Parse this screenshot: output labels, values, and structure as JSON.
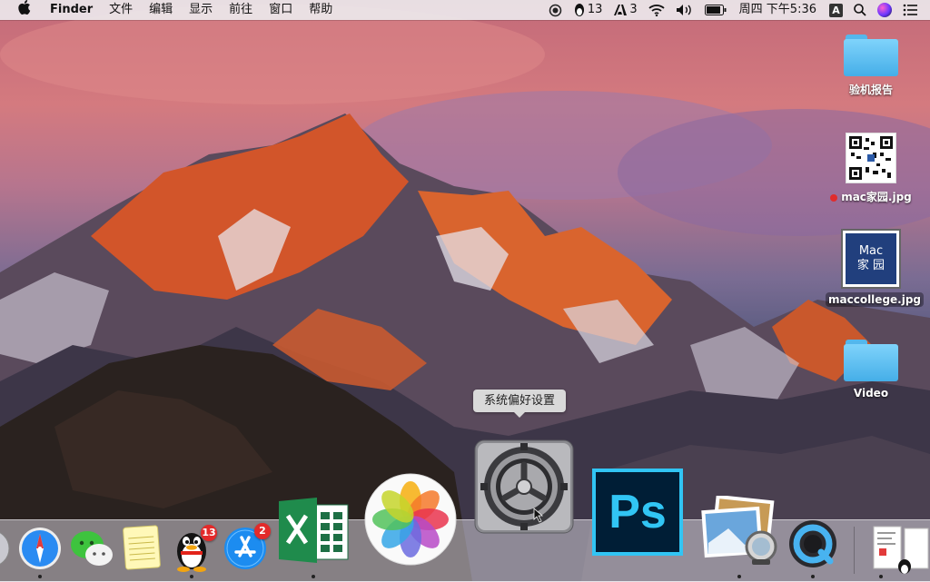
{
  "menubar": {
    "app_name": "Finder",
    "menus": [
      "文件",
      "编辑",
      "显示",
      "前往",
      "窗口",
      "帮助"
    ],
    "qq_count": "13",
    "adobe_count": "3",
    "clock": "周四 下午5:36",
    "input_method": "A"
  },
  "desktop": {
    "items": [
      {
        "label": "验机报告",
        "kind": "folder"
      },
      {
        "label": "mac家园.jpg",
        "kind": "qr-image",
        "tag_color": "#e02c2c"
      },
      {
        "label": "maccollege.jpg",
        "kind": "image",
        "selected": true,
        "thumb_line1": "Mac",
        "thumb_line2": "家 园"
      },
      {
        "label": "Video",
        "kind": "folder"
      }
    ]
  },
  "tooltip": {
    "text": "系统偏好设置"
  },
  "dock": {
    "apps": [
      {
        "name": "launchpad"
      },
      {
        "name": "safari"
      },
      {
        "name": "wechat"
      },
      {
        "name": "notes"
      },
      {
        "name": "qq",
        "badge": "13"
      },
      {
        "name": "app-store",
        "badge": "2"
      },
      {
        "name": "excel"
      },
      {
        "name": "photos"
      },
      {
        "name": "system-preferences"
      },
      {
        "name": "photoshop",
        "label": "Ps"
      },
      {
        "name": "preview"
      },
      {
        "name": "quicktime"
      },
      {
        "name": "documents-stack"
      }
    ]
  },
  "colors": {
    "photoshop_bg": "#001e36",
    "photoshop_accent": "#31c5f4",
    "badge_red": "#e32a2a",
    "folder_blue": "#45aee8"
  }
}
